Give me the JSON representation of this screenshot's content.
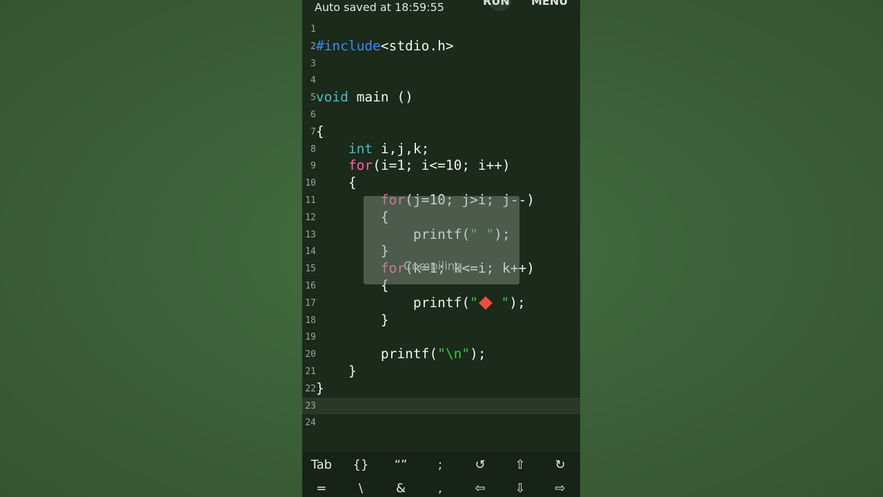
{
  "header": {
    "autosave_text": "Auto saved at 18:59:55",
    "run_label": "RUN",
    "menu_label": "MENU"
  },
  "editor": {
    "active_line": 23,
    "lines": [
      {
        "n": "1"
      },
      {
        "n": "2",
        "segments": [
          [
            "kw-blue",
            "#include"
          ],
          [
            "",
            "<stdio.h>"
          ]
        ]
      },
      {
        "n": "3"
      },
      {
        "n": "4"
      },
      {
        "n": "5",
        "segments": [
          [
            "kw-teal",
            "void"
          ],
          [
            "",
            " main ()"
          ]
        ]
      },
      {
        "n": "6"
      },
      {
        "n": "7",
        "segments": [
          [
            "",
            "{"
          ]
        ]
      },
      {
        "n": "8",
        "segments": [
          [
            "",
            "    "
          ],
          [
            "kw-teal",
            "int"
          ],
          [
            "",
            " i,j,k;"
          ]
        ]
      },
      {
        "n": "9",
        "segments": [
          [
            "",
            "    "
          ],
          [
            "kw-pink",
            "for"
          ],
          [
            "",
            "(i=1; i<=10; i++)"
          ]
        ]
      },
      {
        "n": "10",
        "segments": [
          [
            "",
            "    {"
          ]
        ]
      },
      {
        "n": "11",
        "segments": [
          [
            "",
            "        "
          ],
          [
            "kw-pink",
            "for"
          ],
          [
            "",
            "(j=10; j>i; j--)"
          ]
        ]
      },
      {
        "n": "12",
        "segments": [
          [
            "",
            "        {"
          ]
        ]
      },
      {
        "n": "13",
        "segments": [
          [
            "",
            "            printf("
          ],
          [
            "str",
            "\" \""
          ],
          [
            "",
            ");"
          ]
        ]
      },
      {
        "n": "14",
        "segments": [
          [
            "",
            "        }"
          ]
        ]
      },
      {
        "n": "15",
        "segments": [
          [
            "",
            "        "
          ],
          [
            "kw-pink",
            "for"
          ],
          [
            "",
            "(k=1; k<=i; k++)"
          ]
        ]
      },
      {
        "n": "16",
        "segments": [
          [
            "",
            "        {"
          ]
        ]
      },
      {
        "n": "17",
        "segments": [
          [
            "",
            "            printf("
          ],
          [
            "str",
            "\""
          ],
          [
            "diamond",
            ""
          ],
          [
            "str",
            " \""
          ],
          [
            "",
            ");"
          ]
        ]
      },
      {
        "n": "18",
        "segments": [
          [
            "",
            "        }"
          ]
        ]
      },
      {
        "n": "19"
      },
      {
        "n": "20",
        "segments": [
          [
            "",
            "        printf("
          ],
          [
            "str",
            "\"\\n\""
          ],
          [
            "",
            ");"
          ]
        ]
      },
      {
        "n": "21",
        "segments": [
          [
            "",
            "    }"
          ]
        ]
      },
      {
        "n": "22",
        "segments": [
          [
            "",
            "}"
          ]
        ]
      },
      {
        "n": "23"
      },
      {
        "n": "24"
      }
    ]
  },
  "toast": {
    "text": "Compiling..."
  },
  "keyboard": {
    "row1": [
      "Tab",
      "{}",
      "“”",
      ";",
      "↺",
      "⇧",
      "↻"
    ],
    "row2": [
      "=",
      "\\",
      "&",
      ",",
      "⇦",
      "⇩",
      "⇨"
    ]
  },
  "icons": {
    "diamond": "red-diamond-emoji",
    "undo": "undo-icon",
    "redo": "redo-icon",
    "arrows": "arrow-keys-icons"
  },
  "colors": {
    "background": "#3b5f37",
    "editor_bg": "#1b2a1b",
    "keyword_blue": "#2f8cff",
    "keyword_teal": "#3fc1c9",
    "keyword_pink": "#ff5ea8",
    "string_green": "#2ecc40"
  }
}
